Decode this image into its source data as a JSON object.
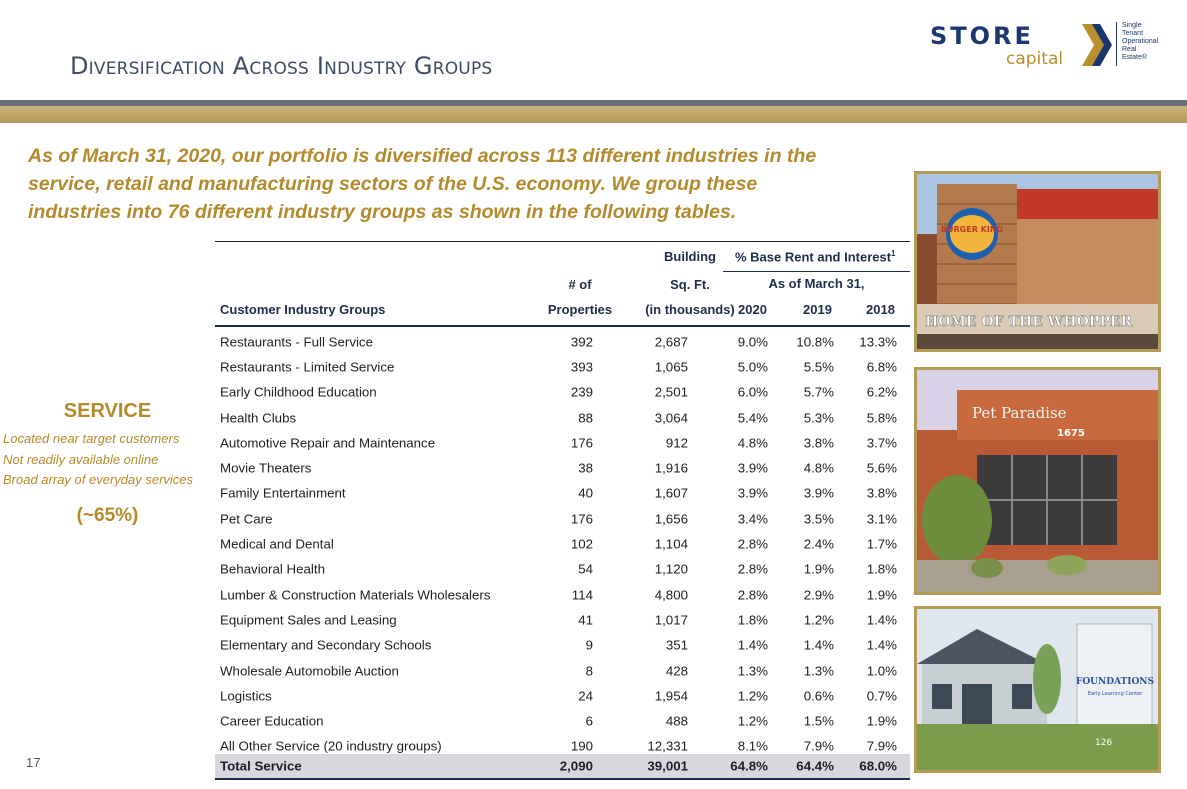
{
  "slide": {
    "title": "Diversification Across Industry Groups",
    "page_number": "17",
    "intro": "As of March 31, 2020, our portfolio is diversified across 113 different industries in the service, retail and manufacturing sectors of the U.S. economy. We group these industries into 76 different industry groups as shown in the following tables."
  },
  "logo": {
    "word": "STORE",
    "sub": "capital",
    "tagline": [
      "Single",
      "Tenant",
      "Operational",
      "Real",
      "Estate®"
    ]
  },
  "sidebar": {
    "heading": "SERVICE",
    "notes": [
      "Located near target customers",
      "Not readily available online",
      "Broad array of everyday services"
    ],
    "percent": "(~65%)"
  },
  "table": {
    "headers": {
      "group": "Customer Industry Groups",
      "props_top": "# of",
      "props_bottom": "Properties",
      "sqft_top": "Building",
      "sqft_mid": "Sq. Ft.",
      "sqft_bottom": "(in thousands)",
      "rent_title": "% Base Rent and Interest",
      "rent_sup": "1",
      "rent_sub": "As of March 31,",
      "y2020": "2020",
      "y2019": "2019",
      "y2018": "2018"
    },
    "rows": [
      {
        "name": "Restaurants - Full Service",
        "props": "392",
        "sqft": "2,687",
        "r2020": "9.0%",
        "r2019": "10.8%",
        "r2018": "13.3%"
      },
      {
        "name": "Restaurants - Limited Service",
        "props": "393",
        "sqft": "1,065",
        "r2020": "5.0%",
        "r2019": "5.5%",
        "r2018": "6.8%"
      },
      {
        "name": "Early Childhood Education",
        "props": "239",
        "sqft": "2,501",
        "r2020": "6.0%",
        "r2019": "5.7%",
        "r2018": "6.2%"
      },
      {
        "name": "Health Clubs",
        "props": "88",
        "sqft": "3,064",
        "r2020": "5.4%",
        "r2019": "5.3%",
        "r2018": "5.8%"
      },
      {
        "name": "Automotive Repair and Maintenance",
        "props": "176",
        "sqft": "912",
        "r2020": "4.8%",
        "r2019": "3.8%",
        "r2018": "3.7%"
      },
      {
        "name": "Movie Theaters",
        "props": "38",
        "sqft": "1,916",
        "r2020": "3.9%",
        "r2019": "4.8%",
        "r2018": "5.6%"
      },
      {
        "name": "Family Entertainment",
        "props": "40",
        "sqft": "1,607",
        "r2020": "3.9%",
        "r2019": "3.9%",
        "r2018": "3.8%"
      },
      {
        "name": "Pet Care",
        "props": "176",
        "sqft": "1,656",
        "r2020": "3.4%",
        "r2019": "3.5%",
        "r2018": "3.1%"
      },
      {
        "name": "Medical and Dental",
        "props": "102",
        "sqft": "1,104",
        "r2020": "2.8%",
        "r2019": "2.4%",
        "r2018": "1.7%"
      },
      {
        "name": "Behavioral Health",
        "props": "54",
        "sqft": "1,120",
        "r2020": "2.8%",
        "r2019": "1.9%",
        "r2018": "1.8%"
      },
      {
        "name": "Lumber & Construction Materials Wholesalers",
        "props": "114",
        "sqft": "4,800",
        "r2020": "2.8%",
        "r2019": "2.9%",
        "r2018": "1.9%"
      },
      {
        "name": "Equipment Sales and Leasing",
        "props": "41",
        "sqft": "1,017",
        "r2020": "1.8%",
        "r2019": "1.2%",
        "r2018": "1.4%"
      },
      {
        "name": "Elementary and Secondary Schools",
        "props": "9",
        "sqft": "351",
        "r2020": "1.4%",
        "r2019": "1.4%",
        "r2018": "1.4%"
      },
      {
        "name": "Wholesale Automobile Auction",
        "props": "8",
        "sqft": "428",
        "r2020": "1.3%",
        "r2019": "1.3%",
        "r2018": "1.0%"
      },
      {
        "name": "Logistics",
        "props": "24",
        "sqft": "1,954",
        "r2020": "1.2%",
        "r2019": "0.6%",
        "r2018": "0.7%"
      },
      {
        "name": "Career Education",
        "props": "6",
        "sqft": "488",
        "r2020": "1.2%",
        "r2019": "1.5%",
        "r2018": "1.9%"
      },
      {
        "name": "All Other Service (20 industry groups)",
        "props": "190",
        "sqft": "12,331",
        "r2020": "8.1%",
        "r2019": "7.9%",
        "r2018": "7.9%"
      }
    ],
    "total": {
      "name": "Total Service",
      "props": "2,090",
      "sqft": "39,001",
      "r2020": "64.8%",
      "r2019": "64.4%",
      "r2018": "68.0%"
    }
  },
  "photos": {
    "burger_king": {
      "sign": "BURGER KING",
      "banner": "HOME OF THE WHOPPER"
    },
    "pet_paradise": {
      "sign": "Pet Paradise",
      "number": "1675"
    },
    "foundations": {
      "sign": "FOUNDATIONS",
      "sub": "Early Learning Center",
      "number": "126"
    }
  },
  "colors": {
    "gold": "#b58a2c",
    "navy": "#1f2d4d",
    "frame": "#b59b58"
  }
}
